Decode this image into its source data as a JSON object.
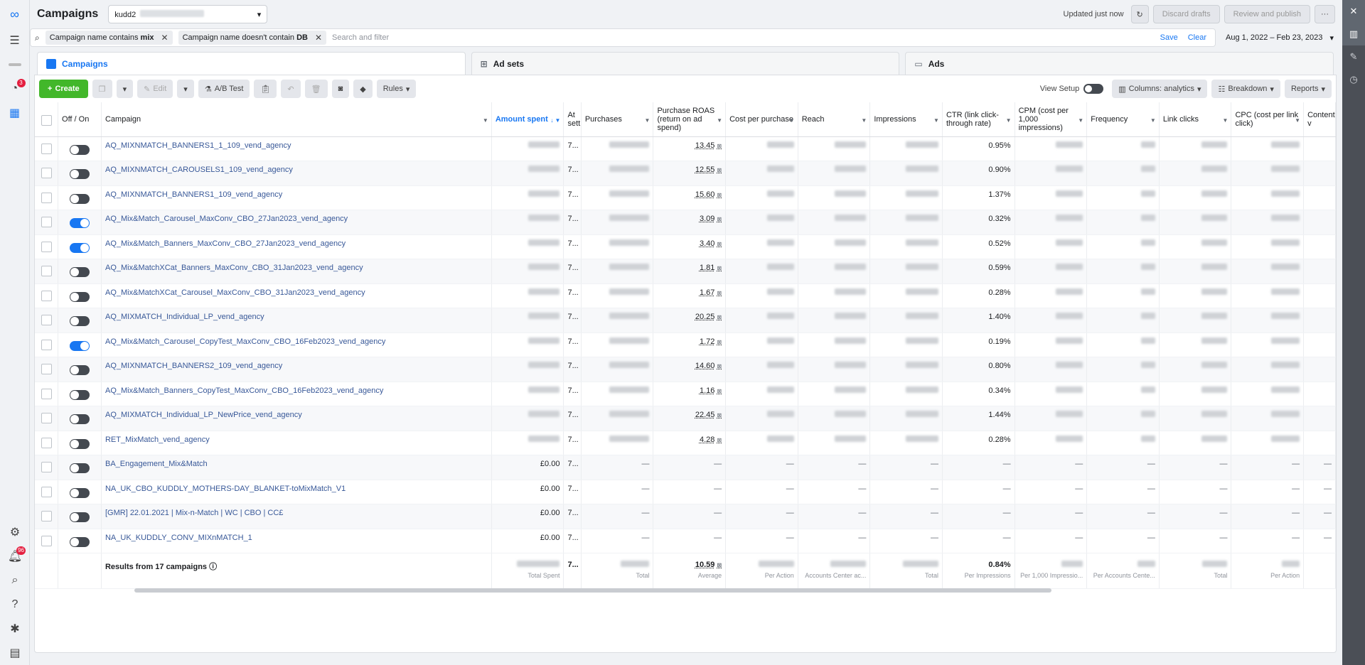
{
  "topbar": {
    "title": "Campaigns",
    "account": "kudd2",
    "updated": "Updated just now",
    "discard": "Discard drafts",
    "review": "Review and publish",
    "more": "···"
  },
  "filters": {
    "chip1_prefix": "Campaign name contains",
    "chip1_value": "mix",
    "chip2_prefix": "Campaign name doesn't contain",
    "chip2_value": "DB",
    "placeholder": "Search and filter",
    "save": "Save",
    "clear": "Clear",
    "date_range": "Aug 1, 2022 – Feb 23, 2023"
  },
  "rail": {
    "notif_badge": "3",
    "alerts_badge": "96"
  },
  "tabs": [
    "Campaigns",
    "Ad sets",
    "Ads"
  ],
  "toolbar": {
    "create": "Create",
    "edit": "Edit",
    "ab_test": "A/B Test",
    "rules": "Rules",
    "view_setup": "View Setup",
    "columns": "Columns: analytics",
    "breakdown": "Breakdown",
    "reports": "Reports"
  },
  "columns": {
    "offon": "Off / On",
    "campaign": "Campaign",
    "amount_spent": "Amount spent",
    "attribution": "At sett",
    "purchases": "Purchases",
    "roas": "Purchase ROAS (return on ad spend)",
    "cpp": "Cost per purchase",
    "reach": "Reach",
    "impressions": "Impressions",
    "ctr": "CTR (link click-through rate)",
    "cpm": "CPM (cost per 1,000 impressions)",
    "frequency": "Frequency",
    "link_clicks": "Link clicks",
    "cpc": "CPC (cost per link click)",
    "content": "Content v"
  },
  "rows": [
    {
      "name": "AQ_MIXNMATCH_BANNERS1_1_109_vend_agency",
      "on": false,
      "spent": "",
      "attr": "7...",
      "roas": "13.45",
      "ctr": "0.95%"
    },
    {
      "name": "AQ_MIXNMATCH_CAROUSELS1_109_vend_agency",
      "on": false,
      "spent": "",
      "attr": "7...",
      "roas": "12.55",
      "ctr": "0.90%"
    },
    {
      "name": "AQ_MIXNMATCH_BANNERS1_109_vend_agency",
      "on": false,
      "spent": "",
      "attr": "7...",
      "roas": "15.60",
      "ctr": "1.37%"
    },
    {
      "name": "AQ_Mix&Match_Carousel_MaxConv_CBO_27Jan2023_vend_agency",
      "on": true,
      "spent": "",
      "attr": "7...",
      "roas": "3.09",
      "ctr": "0.32%"
    },
    {
      "name": "AQ_Mix&Match_Banners_MaxConv_CBO_27Jan2023_vend_agency",
      "on": true,
      "spent": "",
      "attr": "7...",
      "roas": "3.40",
      "ctr": "0.52%"
    },
    {
      "name": "AQ_Mix&MatchXCat_Banners_MaxConv_CBO_31Jan2023_vend_agency",
      "on": false,
      "spent": "",
      "attr": "7...",
      "roas": "1.81",
      "ctr": "0.59%"
    },
    {
      "name": "AQ_Mix&MatchXCat_Carousel_MaxConv_CBO_31Jan2023_vend_agency",
      "on": false,
      "spent": "",
      "attr": "7...",
      "roas": "1.67",
      "ctr": "0.28%"
    },
    {
      "name": "AQ_MIXMATCH_Individual_LP_vend_agency",
      "on": false,
      "spent": "",
      "attr": "7...",
      "roas": "20.25",
      "ctr": "1.40%"
    },
    {
      "name": "AQ_Mix&Match_Carousel_CopyTest_MaxConv_CBO_16Feb2023_vend_agency",
      "on": true,
      "spent": "",
      "attr": "7...",
      "roas": "1.72",
      "ctr": "0.19%"
    },
    {
      "name": "AQ_MIXNMATCH_BANNERS2_109_vend_agency",
      "on": false,
      "spent": "",
      "attr": "7...",
      "roas": "14.60",
      "ctr": "0.80%"
    },
    {
      "name": "AQ_Mix&Match_Banners_CopyTest_MaxConv_CBO_16Feb2023_vend_agency",
      "on": false,
      "spent": "",
      "attr": "7...",
      "roas": "1.16",
      "ctr": "0.34%"
    },
    {
      "name": "AQ_MIXMATCH_Individual_LP_NewPrice_vend_agency",
      "on": false,
      "spent": "",
      "attr": "7...",
      "roas": "22.45",
      "ctr": "1.44%"
    },
    {
      "name": "RET_MixMatch_vend_agency",
      "on": false,
      "spent": "",
      "attr": "7...",
      "roas": "4.28",
      "ctr": "0.28%"
    },
    {
      "name": "BA_Engagement_Mix&Match",
      "on": false,
      "spent": "£0.00",
      "attr": "7...",
      "roas": "",
      "ctr": ""
    },
    {
      "name": "NA_UK_CBO_KUDDLY_MOTHERS-DAY_BLANKET-toMixMatch_V1",
      "on": false,
      "spent": "£0.00",
      "attr": "7...",
      "roas": "",
      "ctr": ""
    },
    {
      "name": "[GMR] 22.01.2021 | Mix-n-Match | WC | CBO | CC£",
      "on": false,
      "spent": "£0.00",
      "attr": "7...",
      "roas": "",
      "ctr": ""
    },
    {
      "name": "NA_UK_KUDDLY_CONV_MIXnMATCH_1",
      "on": false,
      "spent": "£0.00",
      "attr": "7...",
      "roas": "",
      "ctr": ""
    }
  ],
  "dash": "—",
  "totals": {
    "label": "Results from 17 campaigns",
    "spent_sub": "Total Spent",
    "attr": "7...",
    "purchases_sub": "Total",
    "roas": "10.59",
    "roas_sub": "Average",
    "cpp_sub": "Per Action",
    "reach_sub": "Accounts Center ac...",
    "impr_sub": "Total",
    "ctr": "0.84%",
    "ctr_sub": "Per Impressions",
    "cpm_sub": "Per 1,000 Impressio...",
    "freq_sub": "Per Accounts Cente...",
    "clicks_sub": "Total",
    "cpc_sub": "Per Action"
  }
}
